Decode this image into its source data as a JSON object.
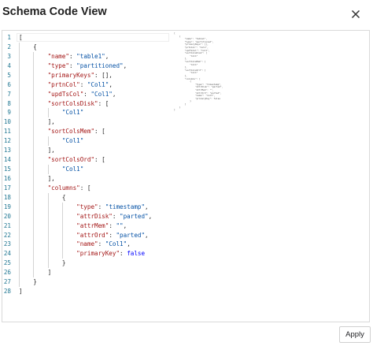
{
  "dialog": {
    "title": "Schema Code View",
    "close_icon": "close-icon",
    "apply_label": "Apply"
  },
  "editor": {
    "language": "json",
    "lines": [
      [
        {
          "t": "[",
          "c": "punc"
        }
      ],
      [
        {
          "t": "    {",
          "c": "punc"
        }
      ],
      [
        {
          "t": "        ",
          "c": "punc"
        },
        {
          "t": "\"name\"",
          "c": "key"
        },
        {
          "t": ": ",
          "c": "punc"
        },
        {
          "t": "\"table1\"",
          "c": "str"
        },
        {
          "t": ",",
          "c": "punc"
        }
      ],
      [
        {
          "t": "        ",
          "c": "punc"
        },
        {
          "t": "\"type\"",
          "c": "key"
        },
        {
          "t": ": ",
          "c": "punc"
        },
        {
          "t": "\"partitioned\"",
          "c": "str"
        },
        {
          "t": ",",
          "c": "punc"
        }
      ],
      [
        {
          "t": "        ",
          "c": "punc"
        },
        {
          "t": "\"primaryKeys\"",
          "c": "key"
        },
        {
          "t": ": [],",
          "c": "punc"
        }
      ],
      [
        {
          "t": "        ",
          "c": "punc"
        },
        {
          "t": "\"prtnCol\"",
          "c": "key"
        },
        {
          "t": ": ",
          "c": "punc"
        },
        {
          "t": "\"Col1\"",
          "c": "str"
        },
        {
          "t": ",",
          "c": "punc"
        }
      ],
      [
        {
          "t": "        ",
          "c": "punc"
        },
        {
          "t": "\"updTsCol\"",
          "c": "key"
        },
        {
          "t": ": ",
          "c": "punc"
        },
        {
          "t": "\"Col1\"",
          "c": "str"
        },
        {
          "t": ",",
          "c": "punc"
        }
      ],
      [
        {
          "t": "        ",
          "c": "punc"
        },
        {
          "t": "\"sortColsDisk\"",
          "c": "key"
        },
        {
          "t": ": [",
          "c": "punc"
        }
      ],
      [
        {
          "t": "            ",
          "c": "punc"
        },
        {
          "t": "\"Col1\"",
          "c": "str"
        }
      ],
      [
        {
          "t": "        ],",
          "c": "punc"
        }
      ],
      [
        {
          "t": "        ",
          "c": "punc"
        },
        {
          "t": "\"sortColsMem\"",
          "c": "key"
        },
        {
          "t": ": [",
          "c": "punc"
        }
      ],
      [
        {
          "t": "            ",
          "c": "punc"
        },
        {
          "t": "\"Col1\"",
          "c": "str"
        }
      ],
      [
        {
          "t": "        ],",
          "c": "punc"
        }
      ],
      [
        {
          "t": "        ",
          "c": "punc"
        },
        {
          "t": "\"sortColsOrd\"",
          "c": "key"
        },
        {
          "t": ": [",
          "c": "punc"
        }
      ],
      [
        {
          "t": "            ",
          "c": "punc"
        },
        {
          "t": "\"Col1\"",
          "c": "str"
        }
      ],
      [
        {
          "t": "        ],",
          "c": "punc"
        }
      ],
      [
        {
          "t": "        ",
          "c": "punc"
        },
        {
          "t": "\"columns\"",
          "c": "key"
        },
        {
          "t": ": [",
          "c": "punc"
        }
      ],
      [
        {
          "t": "            {",
          "c": "punc"
        }
      ],
      [
        {
          "t": "                ",
          "c": "punc"
        },
        {
          "t": "\"type\"",
          "c": "key"
        },
        {
          "t": ": ",
          "c": "punc"
        },
        {
          "t": "\"timestamp\"",
          "c": "str"
        },
        {
          "t": ",",
          "c": "punc"
        }
      ],
      [
        {
          "t": "                ",
          "c": "punc"
        },
        {
          "t": "\"attrDisk\"",
          "c": "key"
        },
        {
          "t": ": ",
          "c": "punc"
        },
        {
          "t": "\"parted\"",
          "c": "str"
        },
        {
          "t": ",",
          "c": "punc"
        }
      ],
      [
        {
          "t": "                ",
          "c": "punc"
        },
        {
          "t": "\"attrMem\"",
          "c": "key"
        },
        {
          "t": ": ",
          "c": "punc"
        },
        {
          "t": "\"\"",
          "c": "str"
        },
        {
          "t": ",",
          "c": "punc"
        }
      ],
      [
        {
          "t": "                ",
          "c": "punc"
        },
        {
          "t": "\"attrOrd\"",
          "c": "key"
        },
        {
          "t": ": ",
          "c": "punc"
        },
        {
          "t": "\"parted\"",
          "c": "str"
        },
        {
          "t": ",",
          "c": "punc"
        }
      ],
      [
        {
          "t": "                ",
          "c": "punc"
        },
        {
          "t": "\"name\"",
          "c": "key"
        },
        {
          "t": ": ",
          "c": "punc"
        },
        {
          "t": "\"Col1\"",
          "c": "str"
        },
        {
          "t": ",",
          "c": "punc"
        }
      ],
      [
        {
          "t": "                ",
          "c": "punc"
        },
        {
          "t": "\"primaryKey\"",
          "c": "key"
        },
        {
          "t": ": ",
          "c": "punc"
        },
        {
          "t": "false",
          "c": "kw"
        }
      ],
      [
        {
          "t": "            }",
          "c": "punc"
        }
      ],
      [
        {
          "t": "        ]",
          "c": "punc"
        }
      ],
      [
        {
          "t": "    }",
          "c": "punc"
        }
      ],
      [
        {
          "t": "]",
          "c": "punc"
        }
      ]
    ],
    "colors": {
      "line_number": "#237893",
      "key": "#a31515",
      "string": "#0451a5",
      "keyword": "#0000ff"
    }
  }
}
